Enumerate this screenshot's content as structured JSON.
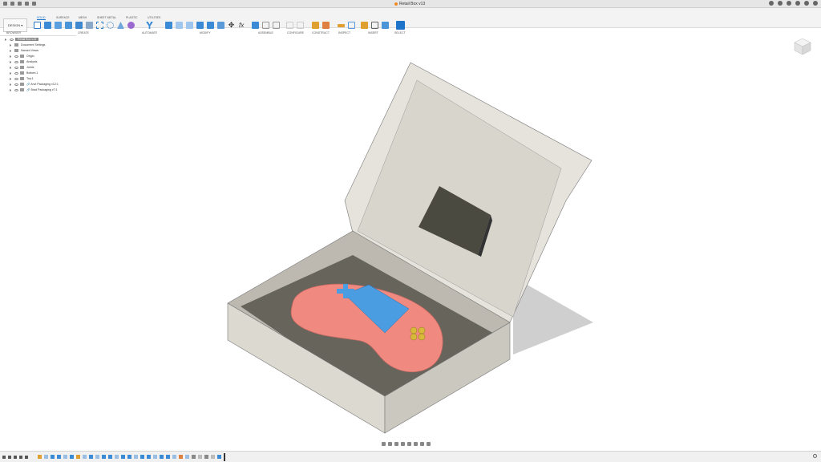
{
  "window": {
    "title": "Retail Box v13"
  },
  "toolbar": {
    "workspace": "DESIGN",
    "tabs": [
      "SOLID",
      "SURFACE",
      "MESH",
      "SHEET METAL",
      "PLASTIC",
      "UTILITIES"
    ],
    "active_tab": "SOLID",
    "groups": [
      "CREATE",
      "AUTOMATE",
      "MODIFY",
      "ASSEMBLE",
      "CONFIGURE",
      "CONSTRUCT",
      "INSPECT",
      "INSERT",
      "SELECT"
    ]
  },
  "browser": {
    "title": "BROWSER",
    "items": [
      {
        "label": "Retail Box v13"
      },
      {
        "label": "Document Settings"
      },
      {
        "label": "Named Views"
      },
      {
        "label": "Origin"
      },
      {
        "label": "Analysis"
      },
      {
        "label": "Joints"
      },
      {
        "label": "Bottom:1"
      },
      {
        "label": "Top:1"
      },
      {
        "label": "Anvl Packaging v12:1"
      },
      {
        "label": "Brad Packaging v7:1"
      }
    ]
  },
  "colors": {
    "accent": "#1d74c9",
    "controller": "#f08a80",
    "screen": "#4a9de0",
    "cardboard": "#dcd9d1",
    "foam": "#4a4a40"
  }
}
